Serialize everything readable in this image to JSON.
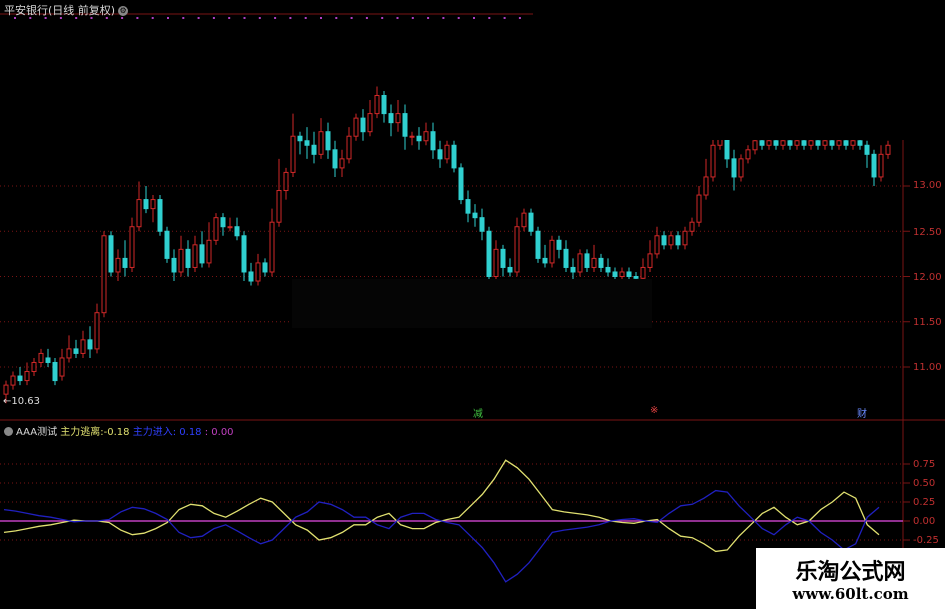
{
  "header": {
    "title": "平安银行(日线 前复权)",
    "settings_icon": "gear-icon"
  },
  "price_axis": {
    "labels": [
      "13.00",
      "12.50",
      "12.00",
      "11.50",
      "11.00"
    ],
    "values": [
      13.0,
      12.5,
      12.0,
      11.5,
      11.0
    ]
  },
  "low_marker": "←10.63",
  "events": {
    "e1": "减",
    "e2": "※",
    "e3": "财"
  },
  "indicator": {
    "name": "AAA测试",
    "series1_label": "主力逃离:",
    "series1_value": "-0.18",
    "series2_label": "主力进入:",
    "series2_value": "0.18",
    "series3_value": ": 0.00",
    "axis_labels": [
      "0.75",
      "0.50",
      "0.25",
      "0.00",
      "-0.25"
    ],
    "axis_values": [
      0.75,
      0.5,
      0.25,
      0.0,
      -0.25
    ]
  },
  "colors": {
    "up": "#d02828",
    "down": "#30d0d0",
    "grid": "#7a1414",
    "line1": "#e0e070",
    "line2": "#2020c0",
    "zero": "#c040c0"
  },
  "watermark": {
    "title": "乐淘公式网",
    "url": "www.60lt.com"
  },
  "chart_data": {
    "type": "candlestick",
    "ylim": [
      10.5,
      13.5
    ],
    "candles": [
      [
        10.7,
        10.8,
        10.6,
        10.85
      ],
      [
        10.8,
        10.9,
        10.75,
        10.95
      ],
      [
        10.9,
        10.85,
        10.8,
        11.0
      ],
      [
        10.85,
        10.95,
        10.8,
        11.05
      ],
      [
        10.95,
        11.05,
        10.9,
        11.1
      ],
      [
        11.05,
        11.15,
        11.0,
        11.2
      ],
      [
        11.1,
        11.05,
        11.0,
        11.2
      ],
      [
        11.05,
        10.85,
        10.8,
        11.1
      ],
      [
        10.9,
        11.1,
        10.85,
        11.2
      ],
      [
        11.1,
        11.2,
        11.05,
        11.35
      ],
      [
        11.2,
        11.15,
        11.1,
        11.3
      ],
      [
        11.15,
        11.3,
        11.1,
        11.4
      ],
      [
        11.3,
        11.2,
        11.1,
        11.45
      ],
      [
        11.2,
        11.6,
        11.15,
        11.7
      ],
      [
        11.6,
        12.45,
        11.55,
        12.5
      ],
      [
        12.45,
        12.05,
        12.0,
        12.5
      ],
      [
        12.05,
        12.2,
        11.95,
        12.3
      ],
      [
        12.2,
        12.1,
        12.0,
        12.4
      ],
      [
        12.1,
        12.55,
        12.05,
        12.65
      ],
      [
        12.55,
        12.85,
        12.5,
        13.05
      ],
      [
        12.85,
        12.75,
        12.7,
        13.0
      ],
      [
        12.75,
        12.85,
        12.6,
        12.9
      ],
      [
        12.85,
        12.5,
        12.45,
        12.9
      ],
      [
        12.5,
        12.2,
        12.15,
        12.55
      ],
      [
        12.2,
        12.05,
        11.95,
        12.3
      ],
      [
        12.05,
        12.3,
        12.0,
        12.45
      ],
      [
        12.3,
        12.1,
        12.0,
        12.4
      ],
      [
        12.1,
        12.35,
        12.05,
        12.45
      ],
      [
        12.35,
        12.15,
        12.1,
        12.5
      ],
      [
        12.15,
        12.4,
        12.1,
        12.6
      ],
      [
        12.4,
        12.65,
        12.35,
        12.7
      ],
      [
        12.65,
        12.55,
        12.45,
        12.7
      ],
      [
        12.55,
        12.55,
        12.5,
        12.65
      ],
      [
        12.55,
        12.45,
        12.4,
        12.65
      ],
      [
        12.45,
        12.05,
        11.95,
        12.5
      ],
      [
        12.05,
        11.95,
        11.9,
        12.15
      ],
      [
        11.95,
        12.15,
        11.9,
        12.25
      ],
      [
        12.15,
        12.05,
        12.0,
        12.2
      ],
      [
        12.05,
        12.6,
        12.0,
        12.75
      ],
      [
        12.6,
        12.95,
        12.55,
        13.3
      ],
      [
        12.95,
        13.15,
        12.85,
        13.2
      ],
      [
        13.15,
        13.55,
        13.1,
        13.8
      ],
      [
        13.55,
        13.5,
        13.35,
        13.6
      ],
      [
        13.5,
        13.45,
        13.3,
        13.65
      ],
      [
        13.45,
        13.35,
        13.25,
        13.6
      ],
      [
        13.35,
        13.6,
        13.3,
        13.75
      ],
      [
        13.6,
        13.4,
        13.3,
        13.7
      ],
      [
        13.4,
        13.2,
        13.1,
        13.5
      ],
      [
        13.2,
        13.3,
        13.1,
        13.4
      ],
      [
        13.3,
        13.55,
        13.25,
        13.65
      ],
      [
        13.55,
        13.75,
        13.5,
        13.8
      ],
      [
        13.75,
        13.6,
        13.5,
        13.85
      ],
      [
        13.6,
        13.8,
        13.55,
        13.95
      ],
      [
        13.8,
        14.0,
        13.75,
        14.1
      ],
      [
        14.0,
        13.8,
        13.7,
        14.05
      ],
      [
        13.8,
        13.7,
        13.55,
        13.9
      ],
      [
        13.7,
        13.8,
        13.6,
        13.95
      ],
      [
        13.8,
        13.55,
        13.4,
        13.9
      ],
      [
        13.55,
        13.55,
        13.45,
        13.6
      ],
      [
        13.55,
        13.5,
        13.4,
        13.65
      ],
      [
        13.5,
        13.6,
        13.45,
        13.7
      ],
      [
        13.6,
        13.4,
        13.3,
        13.7
      ],
      [
        13.4,
        13.3,
        13.2,
        13.5
      ],
      [
        13.3,
        13.45,
        13.25,
        13.5
      ],
      [
        13.45,
        13.2,
        13.15,
        13.5
      ],
      [
        13.2,
        12.85,
        12.8,
        13.25
      ],
      [
        12.85,
        12.7,
        12.6,
        12.95
      ],
      [
        12.7,
        12.65,
        12.55,
        12.8
      ],
      [
        12.65,
        12.5,
        12.4,
        12.75
      ],
      [
        12.5,
        12.0,
        11.95,
        12.55
      ],
      [
        12.0,
        12.3,
        11.95,
        12.4
      ],
      [
        12.3,
        12.1,
        12.0,
        12.35
      ],
      [
        12.1,
        12.05,
        12.0,
        12.2
      ],
      [
        12.05,
        12.55,
        12.0,
        12.65
      ],
      [
        12.55,
        12.7,
        12.5,
        12.75
      ],
      [
        12.7,
        12.5,
        12.45,
        12.75
      ],
      [
        12.5,
        12.2,
        12.15,
        12.55
      ],
      [
        12.2,
        12.15,
        12.1,
        12.35
      ],
      [
        12.15,
        12.4,
        12.1,
        12.45
      ],
      [
        12.4,
        12.3,
        12.2,
        12.45
      ],
      [
        12.3,
        12.1,
        12.05,
        12.4
      ],
      [
        12.1,
        12.05,
        11.95,
        12.2
      ],
      [
        12.05,
        12.25,
        12.0,
        12.3
      ],
      [
        12.25,
        12.1,
        12.05,
        12.3
      ],
      [
        12.1,
        12.2,
        12.05,
        12.35
      ],
      [
        12.2,
        12.1,
        12.05,
        12.25
      ],
      [
        12.1,
        12.05,
        12.0,
        12.2
      ],
      [
        12.05,
        12.0,
        11.95,
        12.1
      ],
      [
        12.0,
        12.05,
        11.95,
        12.1
      ],
      [
        12.05,
        12.0,
        11.95,
        12.1
      ],
      [
        12.0,
        11.98,
        11.95,
        12.05
      ],
      [
        11.98,
        12.1,
        11.95,
        12.2
      ],
      [
        12.1,
        12.25,
        12.05,
        12.4
      ],
      [
        12.25,
        12.45,
        12.2,
        12.55
      ],
      [
        12.45,
        12.35,
        12.3,
        12.5
      ],
      [
        12.35,
        12.45,
        12.3,
        12.5
      ],
      [
        12.45,
        12.35,
        12.3,
        12.5
      ],
      [
        12.35,
        12.5,
        12.3,
        12.55
      ],
      [
        12.5,
        12.6,
        12.45,
        12.65
      ],
      [
        12.6,
        12.9,
        12.55,
        13.0
      ],
      [
        12.9,
        13.1,
        12.85,
        13.3
      ],
      [
        13.1,
        13.45,
        13.05,
        13.6
      ],
      [
        13.45,
        13.55,
        13.4,
        13.6
      ],
      [
        13.55,
        13.3,
        13.2,
        13.6
      ],
      [
        13.3,
        13.1,
        12.95,
        13.4
      ],
      [
        13.1,
        13.3,
        13.05,
        13.35
      ],
      [
        13.3,
        13.4,
        13.25,
        13.45
      ],
      [
        13.4,
        13.5,
        13.35,
        13.55
      ],
      [
        13.5,
        13.45,
        13.4,
        13.55
      ],
      [
        13.45,
        13.5,
        13.4,
        13.55
      ],
      [
        13.5,
        13.45,
        13.4,
        13.55
      ],
      [
        13.45,
        13.5,
        13.4,
        13.55
      ],
      [
        13.5,
        13.45,
        13.4,
        13.55
      ],
      [
        13.45,
        13.5,
        13.4,
        13.55
      ],
      [
        13.5,
        13.45,
        13.4,
        13.55
      ],
      [
        13.45,
        13.5,
        13.4,
        13.55
      ],
      [
        13.5,
        13.45,
        13.4,
        13.55
      ],
      [
        13.45,
        13.5,
        13.4,
        13.55
      ],
      [
        13.5,
        13.45,
        13.4,
        13.55
      ],
      [
        13.45,
        13.5,
        13.4,
        13.55
      ],
      [
        13.5,
        13.45,
        13.4,
        13.55
      ],
      [
        13.45,
        13.5,
        13.4,
        13.55
      ],
      [
        13.5,
        13.45,
        13.4,
        13.55
      ],
      [
        13.45,
        13.35,
        13.2,
        13.5
      ],
      [
        13.35,
        13.1,
        13.0,
        13.4
      ],
      [
        13.1,
        13.35,
        13.05,
        13.45
      ],
      [
        13.35,
        13.45,
        13.3,
        13.5
      ]
    ],
    "indicator_ylim": [
      -0.5,
      0.95
    ],
    "series": [
      {
        "name": "主力逃离",
        "values": [
          -0.15,
          -0.13,
          -0.1,
          -0.07,
          -0.05,
          -0.02,
          0.01,
          0.0,
          0.0,
          -0.02,
          -0.12,
          -0.18,
          -0.16,
          -0.1,
          -0.02,
          0.15,
          0.22,
          0.2,
          0.1,
          0.05,
          0.13,
          0.22,
          0.3,
          0.25,
          0.1,
          -0.05,
          -0.12,
          -0.25,
          -0.22,
          -0.15,
          -0.05,
          -0.05,
          0.05,
          0.1,
          -0.05,
          -0.1,
          -0.1,
          -0.02,
          0.02,
          0.05,
          0.2,
          0.35,
          0.55,
          0.8,
          0.7,
          0.55,
          0.35,
          0.15,
          0.12,
          0.1,
          0.08,
          0.05,
          0.0,
          -0.02,
          -0.03,
          0.0,
          0.02,
          -0.1,
          -0.2,
          -0.22,
          -0.3,
          -0.4,
          -0.38,
          -0.2,
          -0.05,
          0.1,
          0.18,
          0.05,
          -0.05,
          0.0,
          0.15,
          0.25,
          0.38,
          0.3,
          -0.05,
          -0.18
        ]
      },
      {
        "name": "主力进入",
        "values": [
          0.15,
          0.13,
          0.1,
          0.07,
          0.05,
          0.02,
          -0.01,
          0.0,
          0.0,
          0.02,
          0.12,
          0.18,
          0.16,
          0.1,
          0.02,
          -0.15,
          -0.22,
          -0.2,
          -0.1,
          -0.05,
          -0.13,
          -0.22,
          -0.3,
          -0.25,
          -0.1,
          0.05,
          0.12,
          0.25,
          0.22,
          0.15,
          0.05,
          0.05,
          -0.05,
          -0.1,
          0.05,
          0.1,
          0.1,
          0.02,
          -0.02,
          -0.05,
          -0.2,
          -0.35,
          -0.55,
          -0.8,
          -0.7,
          -0.55,
          -0.35,
          -0.15,
          -0.12,
          -0.1,
          -0.08,
          -0.05,
          0.0,
          0.02,
          0.03,
          0.0,
          -0.02,
          0.1,
          0.2,
          0.22,
          0.3,
          0.4,
          0.38,
          0.2,
          0.05,
          -0.1,
          -0.18,
          -0.05,
          0.05,
          0.0,
          -0.15,
          -0.25,
          -0.38,
          -0.3,
          0.05,
          0.18
        ]
      }
    ]
  }
}
